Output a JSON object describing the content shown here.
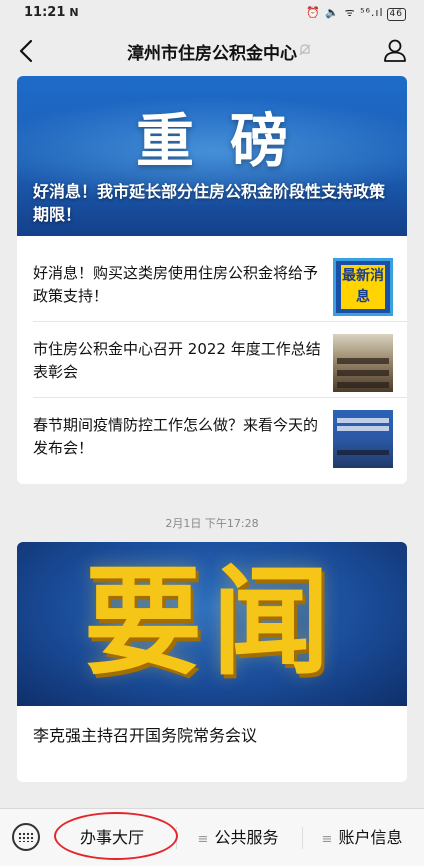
{
  "status_bar": {
    "time": "11:21",
    "time_icon": "N",
    "right_icons": "⏰ 🔈 ᯤ ⁵⁶.ıl",
    "battery": "46"
  },
  "nav": {
    "title": "漳州市住房公积金中心",
    "back_icon": "back-arrow-icon",
    "bell_icon": "notification-muted-icon",
    "profile_icon": "profile-icon"
  },
  "articles_1": {
    "featured": {
      "banner_text": "重磅",
      "title": "好消息！我市延长部分住房公积金阶段性支持政策期限！"
    },
    "items": [
      {
        "title": "好消息！购买这类房使用住房公积金将给予政策支持！",
        "thumb_text": "最新消息"
      },
      {
        "title": "市住房公积金中心召开 2022 年度工作总结表彰会"
      },
      {
        "title": "春节期间疫情防控工作怎么做？来看今天的发布会！"
      }
    ]
  },
  "timestamp": "2月1日 下午17:28",
  "articles_2": {
    "banner_text": "要闻",
    "title": "李克强主持召开国务院常务会议"
  },
  "bottom_menu": {
    "keyboard_icon": "keyboard-icon",
    "items": [
      {
        "label": "办事大厅"
      },
      {
        "label": "公共服务"
      },
      {
        "label": "账户信息"
      }
    ],
    "highlight_color": "#e3262b"
  }
}
